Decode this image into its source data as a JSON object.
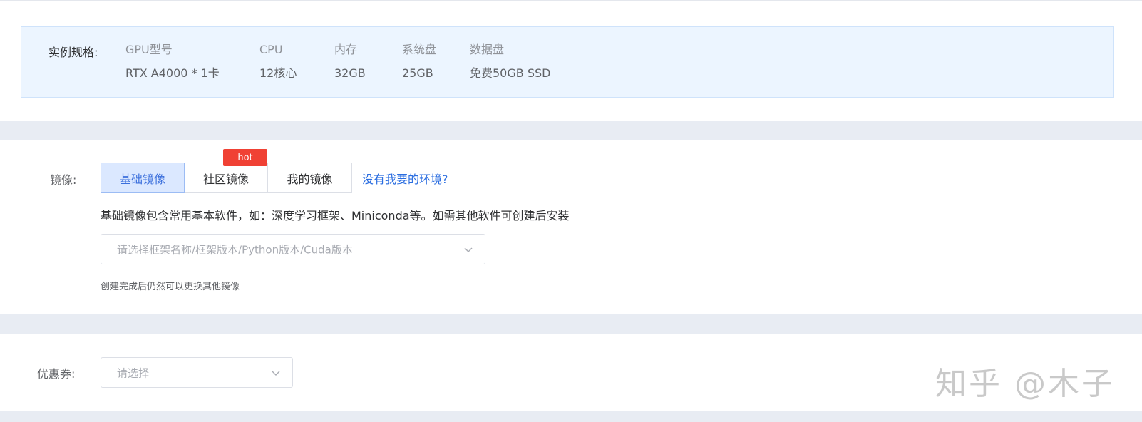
{
  "spec": {
    "label": "实例规格:",
    "columns": [
      {
        "header": "GPU型号",
        "value": "RTX A4000 * 1卡"
      },
      {
        "header": "CPU",
        "value": "12核心"
      },
      {
        "header": "内存",
        "value": "32GB"
      },
      {
        "header": "系统盘",
        "value": "25GB"
      },
      {
        "header": "数据盘",
        "value": "免费50GB SSD"
      }
    ]
  },
  "image": {
    "label": "镜像:",
    "tabs": [
      {
        "label": "基础镜像",
        "active": true
      },
      {
        "label": "社区镜像",
        "active": false
      },
      {
        "label": "我的镜像",
        "active": false
      }
    ],
    "hot_badge": "hot",
    "help_link": "没有我要的环境?",
    "description": "基础镜像包含常用基本软件，如：深度学习框架、Miniconda等。如需其他软件可创建后安装",
    "select_placeholder": "请选择框架名称/框架版本/Python版本/Cuda版本",
    "note": "创建完成后仍然可以更换其他镜像"
  },
  "coupon": {
    "label": "优惠券:",
    "select_placeholder": "请选择"
  },
  "watermark": "知乎 @木子",
  "colors": {
    "accent": "#3b6fdc",
    "link": "#2a6de0",
    "hot": "#f04134",
    "spec_bg": "#ecf5ff"
  }
}
